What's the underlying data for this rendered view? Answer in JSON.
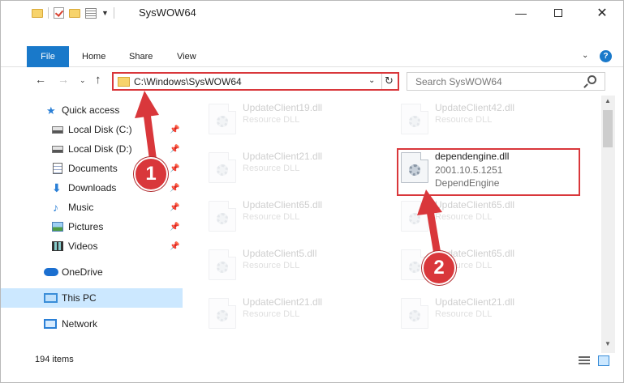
{
  "window": {
    "title": "SysWOW64",
    "controls": {
      "minimize": "—",
      "maximize": "",
      "close": "✕"
    }
  },
  "ribbon": {
    "tabs": [
      "File",
      "Home",
      "Share",
      "View"
    ],
    "help": "?",
    "toggle": "⌄"
  },
  "address_bar": {
    "path": "C:\\Windows\\SysWOW64",
    "search_placeholder": "Search SysWOW64"
  },
  "sidebar": {
    "items": [
      {
        "label": "Quick access",
        "icon": "star-icon",
        "pinned": false
      },
      {
        "label": "Local Disk (C:)",
        "icon": "disk-icon",
        "pinned": true
      },
      {
        "label": "Local Disk (D:)",
        "icon": "disk-icon",
        "pinned": true
      },
      {
        "label": "Documents",
        "icon": "documents-icon",
        "pinned": true
      },
      {
        "label": "Downloads",
        "icon": "downloads-icon",
        "pinned": true
      },
      {
        "label": "Music",
        "icon": "music-icon",
        "pinned": true
      },
      {
        "label": "Pictures",
        "icon": "pictures-icon",
        "pinned": true
      },
      {
        "label": "Videos",
        "icon": "videos-icon",
        "pinned": true
      },
      {
        "label": "OneDrive",
        "icon": "onedrive-icon",
        "pinned": false
      },
      {
        "label": "This PC",
        "icon": "this-pc-icon",
        "pinned": false,
        "selected": true
      },
      {
        "label": "Network",
        "icon": "network-icon",
        "pinned": false
      }
    ]
  },
  "files": {
    "left_column": [
      {
        "name": "UpdateClient19.dll",
        "type": "Resource DLL"
      },
      {
        "name": "UpdateClient21.dll",
        "type": "Resource DLL"
      },
      {
        "name": "UpdateClient65.dll",
        "type": "Resource DLL"
      },
      {
        "name": "UpdateClient5.dll",
        "type": "Resource DLL"
      },
      {
        "name": "UpdateClient21.dll",
        "type": "Resource DLL"
      }
    ],
    "right_column": [
      {
        "name": "UpdateClient42.dll",
        "type": "Resource DLL"
      },
      {
        "name": "UpdateClient65.dll",
        "type": "Resource DLL"
      },
      {
        "name": "UpdateClient65.dll",
        "type": "Resource DLL"
      },
      {
        "name": "UpdateClient21.dll",
        "type": "Resource DLL"
      }
    ],
    "highlighted": {
      "name": "dependengine.dll",
      "version": "2001.10.5.1251",
      "description": "DependEngine"
    }
  },
  "status": {
    "item_count": "194 items"
  },
  "annotations": {
    "step1": "1",
    "step2": "2",
    "color": "#d9373b"
  }
}
